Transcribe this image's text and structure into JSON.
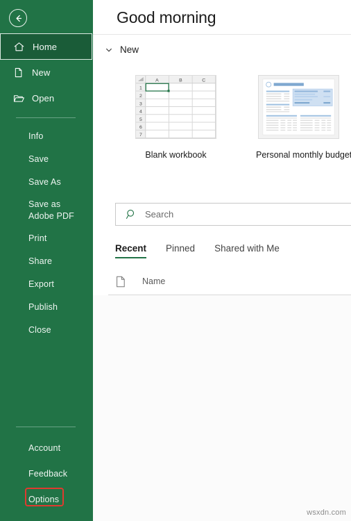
{
  "sidebar": {
    "back_icon": "back-arrow-icon",
    "top_items": [
      {
        "label": "Home",
        "icon": "home-icon",
        "active": true
      },
      {
        "label": "New",
        "icon": "new-document-icon",
        "active": false
      },
      {
        "label": "Open",
        "icon": "open-folder-icon",
        "active": false
      }
    ],
    "list_items": [
      {
        "label": "Info"
      },
      {
        "label": "Save"
      },
      {
        "label": "Save As"
      },
      {
        "label": "Save as Adobe PDF"
      },
      {
        "label": "Print"
      },
      {
        "label": "Share"
      },
      {
        "label": "Export"
      },
      {
        "label": "Publish"
      },
      {
        "label": "Close"
      }
    ],
    "bottom_items": [
      {
        "label": "Account"
      },
      {
        "label": "Feedback"
      },
      {
        "label": "Options"
      }
    ],
    "background_color": "#217346",
    "active_item_color": "#1a5c38"
  },
  "annotation": {
    "highlight_target": "Options",
    "color": "#e03a2f"
  },
  "main": {
    "greeting": "Good morning",
    "new_section": {
      "label": "New",
      "chevron_icon": "chevron-down-icon"
    },
    "templates": [
      {
        "caption": "Blank workbook",
        "thumb": "blank-workbook-grid",
        "columns": [
          "A",
          "B",
          "C"
        ],
        "rows": [
          "1",
          "2",
          "3",
          "4",
          "5",
          "6",
          "7"
        ],
        "selected_cell": "A1"
      },
      {
        "caption": "Personal monthly budget",
        "thumb": "personal-monthly-budget-preview",
        "title": "Personal Monthly Budget",
        "accent_color": "#a8c6e8"
      }
    ],
    "search": {
      "placeholder": "Search",
      "value": "",
      "icon": "search-icon"
    },
    "tabs": [
      {
        "label": "Recent",
        "active": true
      },
      {
        "label": "Pinned",
        "active": false
      },
      {
        "label": "Shared with Me",
        "active": false
      }
    ],
    "list": {
      "icon": "document-icon",
      "column_name": "Name",
      "rows": []
    },
    "accent_color": "#217346"
  },
  "watermark": "wsxdn.com"
}
